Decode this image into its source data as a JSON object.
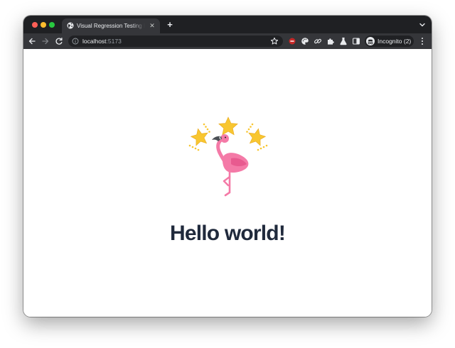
{
  "browser": {
    "tab": {
      "title": "Visual Regression Testing Example",
      "favicon": "globe-icon"
    },
    "new_tab_icon": "plus-icon",
    "tab_search_icon": "chevron-down-icon",
    "toolbar": {
      "back_icon": "arrow-left-icon",
      "forward_icon": "arrow-right-icon",
      "reload_icon": "reload-icon",
      "address": {
        "host": "localhost",
        "port": ":5173",
        "info_icon": "info-icon",
        "bookmark_icon": "star-outline-icon"
      },
      "extensions": [
        "red-extension-icon",
        "palette-icon",
        "link-icon",
        "puzzle-icon",
        "flask-icon",
        "sidepanel-icon"
      ],
      "incognito_label": "Incognito (2)",
      "menu_icon": "kebab-menu-icon"
    }
  },
  "page": {
    "illustration": "flamingo-with-stars",
    "heading": "Hello world!"
  },
  "colors": {
    "tabstrip": "#1f2023",
    "toolbar": "#35363a",
    "heading": "#202a3c",
    "flamingo": "#f47aa7",
    "star": "#f8c630"
  }
}
